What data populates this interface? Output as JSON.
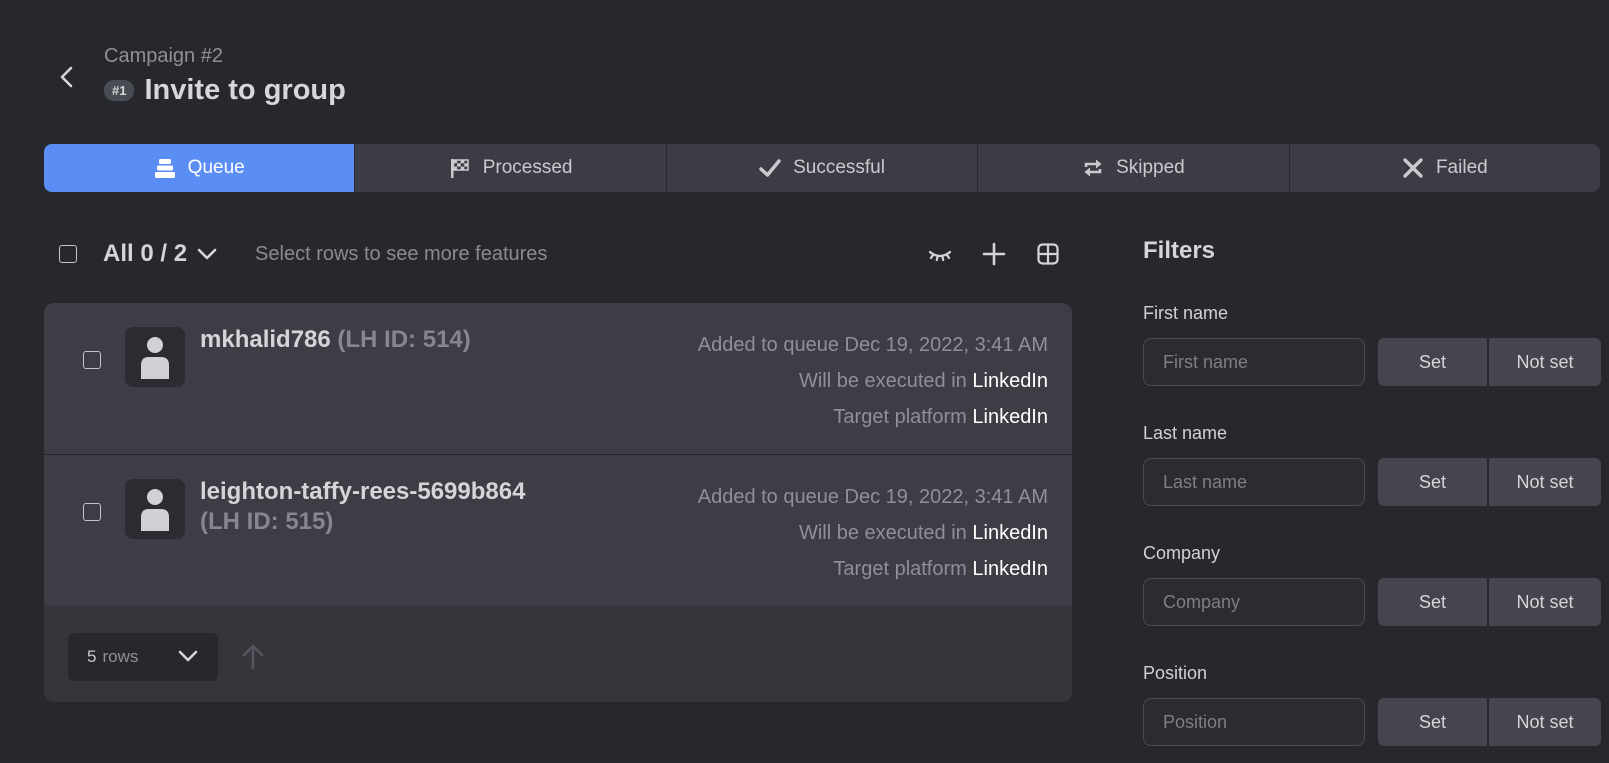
{
  "header": {
    "campaign": "Campaign #2",
    "step_badge": "#1",
    "title": "Invite to group"
  },
  "tabs": [
    {
      "label": "Queue",
      "icon": "queue-stack-icon",
      "active": true
    },
    {
      "label": "Processed",
      "icon": "checkered-flag-icon",
      "active": false
    },
    {
      "label": "Successful",
      "icon": "checkmark-icon",
      "active": false
    },
    {
      "label": "Skipped",
      "icon": "swap-arrows-icon",
      "active": false
    },
    {
      "label": "Failed",
      "icon": "x-icon",
      "active": false
    }
  ],
  "toolbar": {
    "selection": "All 0 / 2",
    "hint": "Select rows to see more features",
    "icons": [
      "hide-eye-icon",
      "add-icon",
      "columns-grid-icon"
    ]
  },
  "rows": [
    {
      "name": "mkhalid786",
      "lh_id": "(LH ID: 514)",
      "added": "Added to queue Dec 19, 2022, 3:41 AM",
      "executed_prefix": "Will be executed in",
      "executed_in": "LinkedIn",
      "target_prefix": "Target platform",
      "target": "LinkedIn"
    },
    {
      "name": "leighton-taffy-rees-5699b864",
      "lh_id": "(LH ID: 515)",
      "added": "Added to queue Dec 19, 2022, 3:41 AM",
      "executed_prefix": "Will be executed in",
      "executed_in": "LinkedIn",
      "target_prefix": "Target platform",
      "target": "LinkedIn"
    }
  ],
  "pagination": {
    "rows_count": "5",
    "rows_label": "rows"
  },
  "filters": {
    "title": "Filters",
    "set_label": "Set",
    "not_set_label": "Not set",
    "fields": [
      {
        "label": "First name",
        "placeholder": "First name"
      },
      {
        "label": "Last name",
        "placeholder": "Last name"
      },
      {
        "label": "Company",
        "placeholder": "Company"
      },
      {
        "label": "Position",
        "placeholder": "Position"
      }
    ]
  },
  "colors": {
    "background": "#27282d",
    "panel": "#3d3e45",
    "accent": "#5b8ef5",
    "text": "#d4d5d9",
    "muted": "#8f9097"
  }
}
